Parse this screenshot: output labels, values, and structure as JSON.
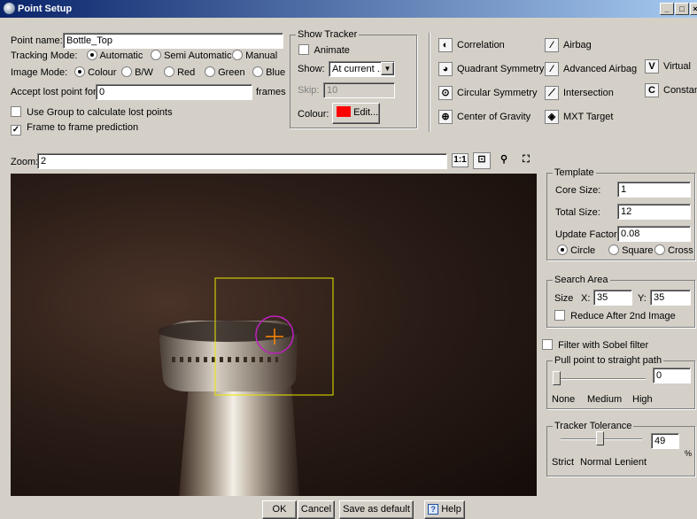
{
  "window": {
    "title": "Point Setup"
  },
  "point": {
    "name_label": "Point name:",
    "name_value": "Bottle_Top",
    "tracking_label": "Tracking Mode:",
    "tracking_options": [
      "Automatic",
      "Semi Automatic",
      "Manual"
    ],
    "tracking_selected": "Automatic",
    "image_label": "Image Mode:",
    "image_options": [
      "Colour",
      "B/W",
      "Red",
      "Green",
      "Blue"
    ],
    "image_selected": "Colour",
    "accept_label": "Accept lost point for",
    "accept_value": "0",
    "accept_unit": "frames",
    "use_group_label": "Use Group to calculate lost points",
    "use_group_checked": false,
    "frame_pred_label": "Frame to frame prediction",
    "frame_pred_checked": true
  },
  "show_tracker": {
    "group_label": "Show Tracker",
    "animate_label": "Animate",
    "animate_checked": false,
    "show_label": "Show:",
    "show_value": "At current ...",
    "skip_label": "Skip:",
    "skip_value": "10",
    "colour_label": "Colour:",
    "colour_swatch": "#ff0000",
    "edit_label": "Edit..."
  },
  "methods": {
    "col1": [
      {
        "name": "Correlation",
        "icon": "correlation-icon",
        "glyph": "◐"
      },
      {
        "name": "Quadrant Symmetry",
        "icon": "quadrant-symmetry-icon",
        "glyph": "◕"
      },
      {
        "name": "Circular Symmetry",
        "icon": "circular-symmetry-icon",
        "glyph": "⊙"
      },
      {
        "name": "Center of Gravity",
        "icon": "center-of-gravity-icon",
        "glyph": "⊕"
      }
    ],
    "col2": [
      {
        "name": "Airbag",
        "icon": "airbag-icon",
        "glyph": "⁄"
      },
      {
        "name": "Advanced Airbag",
        "icon": "advanced-airbag-icon",
        "glyph": "⁄"
      },
      {
        "name": "Intersection",
        "icon": "intersection-icon",
        "glyph": "⟋"
      },
      {
        "name": "MXT Target",
        "icon": "mxt-target-icon",
        "glyph": "◈"
      }
    ],
    "col3": [
      {
        "name": "Virtual",
        "icon": "virtual-icon",
        "glyph": "V"
      },
      {
        "name": "Constan",
        "icon": "constant-icon",
        "glyph": "C"
      }
    ]
  },
  "zoom": {
    "label": "Zoom:",
    "value": "2",
    "one_to_one": "1:1"
  },
  "template": {
    "group_label": "Template",
    "core_label": "Core Size:",
    "core_value": "1",
    "total_label": "Total Size:",
    "total_value": "12",
    "update_label": "Update Factor:",
    "update_value": "0.08",
    "shapes": [
      "Circle",
      "Square",
      "Cross"
    ],
    "shape_selected": "Circle"
  },
  "search_area": {
    "group_label": "Search Area",
    "size_label": "Size",
    "x_label": "X:",
    "x_value": "35",
    "y_label": "Y:",
    "y_value": "35",
    "reduce_label": "Reduce After 2nd Image",
    "reduce_checked": false
  },
  "filter": {
    "label": "Filter with Sobel filter",
    "checked": false
  },
  "pull": {
    "group_label": "Pull point to straight path",
    "value": "0",
    "level": 0,
    "ticks": [
      "None",
      "Medium",
      "High"
    ]
  },
  "tolerance": {
    "group_label": "Tracker Tolerance",
    "value": "49",
    "level": 49,
    "unit": "%",
    "ticks": [
      "Strict",
      "Normal",
      "Lenient"
    ]
  },
  "footer": {
    "ok": "OK",
    "cancel": "Cancel",
    "save_default": "Save as default",
    "help": "Help"
  },
  "colors": {
    "tracker_box": "#e8e800",
    "tracker_circle": "#c020c0",
    "crosshair": "#ff8800"
  }
}
